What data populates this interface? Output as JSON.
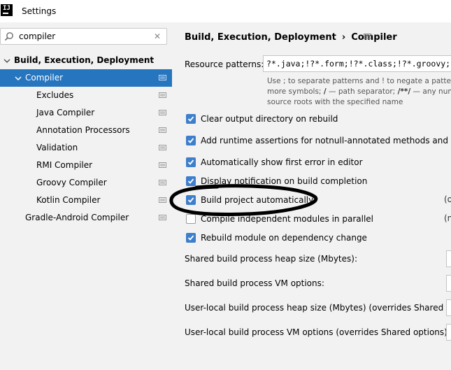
{
  "window": {
    "title": "Settings",
    "logo_text": "IJ"
  },
  "search": {
    "value": "compiler",
    "placeholder": ""
  },
  "tree": {
    "root": "Build, Execution, Deployment",
    "items": [
      {
        "label": "Compiler"
      },
      {
        "label": "Excludes"
      },
      {
        "label": "Java Compiler"
      },
      {
        "label": "Annotation Processors"
      },
      {
        "label": "Validation"
      },
      {
        "label": "RMI Compiler"
      },
      {
        "label": "Groovy Compiler"
      },
      {
        "label": "Kotlin Compiler"
      },
      {
        "label": "Gradle-Android Compiler"
      }
    ]
  },
  "breadcrumb": {
    "parent": "Build, Execution, Deployment",
    "separator": "›",
    "current": "Compiler"
  },
  "resource_patterns": {
    "label": "Resource patterns:",
    "value": "?*.java;!?*.form;!?*.class;!?*.groovy;!?*.scala;!?*.flex;!?*.kt;!?*.clj;!?*.aj",
    "hint_line1": "Use ; to separate patterns and ! to negate a pattern.",
    "hint_line2_pre": "more symbols; ",
    "hint_line2_b1": "/",
    "hint_line2_mid": " — path separator; ",
    "hint_line2_b2": "/**/",
    "hint_line2_post": " — any number of directories;",
    "hint_line3": "source roots with the specified name"
  },
  "options": [
    {
      "label": "Clear output directory on rebuild",
      "checked": true
    },
    {
      "label": "Add runtime assertions for notnull-annotated methods and parameters",
      "checked": true
    },
    {
      "label": "Automatically show first error in editor",
      "checked": true
    },
    {
      "label": "Display notification on build completion",
      "checked": true
    },
    {
      "label": "Build project automatically",
      "checked": true,
      "note": "(o"
    },
    {
      "label": "Compile independent modules in parallel",
      "checked": false,
      "note": "(n"
    },
    {
      "label": "Rebuild module on dependency change",
      "checked": true
    }
  ],
  "fields": [
    {
      "label": "Shared build process heap size (Mbytes):"
    },
    {
      "label": "Shared build process VM options:"
    },
    {
      "label": "User-local build process heap size (Mbytes) (overrides Shared size):"
    },
    {
      "label": "User-local build process VM options (overrides Shared options):"
    }
  ],
  "colors": {
    "selection": "#2675bf",
    "checkbox": "#3d7fcc",
    "annotation": "#000000"
  },
  "icons": [
    "app-logo-icon",
    "search-icon",
    "clear-icon",
    "expand-arrow-icon",
    "project-scope-icon",
    "checkmark-icon"
  ]
}
